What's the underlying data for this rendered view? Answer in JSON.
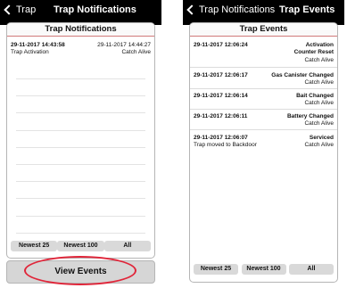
{
  "left_screen": {
    "nav_back_label": "Trap",
    "nav_title": "Trap Notifications",
    "panel_title": "Trap Notifications",
    "notification": {
      "left_time": "29-11-2017 14:43:58",
      "right_time": "29-11-2017 14:44:27",
      "type": "Trap Activation",
      "status": "Catch Alive"
    },
    "filters": [
      "Newest 25",
      "Newest 100",
      "All"
    ],
    "view_events_label": "View Events"
  },
  "right_screen": {
    "nav_back_label": "Trap Notifications",
    "nav_title": "Trap Events",
    "panel_title": "Trap Events",
    "events": [
      {
        "time": "29-11-2017 12:06:24",
        "title": "Activation",
        "title2": "Counter Reset",
        "status": "Catch Alive",
        "note": ""
      },
      {
        "time": "29-11-2017 12:06:17",
        "title": "Gas Canister Changed",
        "title2": "",
        "status": "Catch Alive",
        "note": ""
      },
      {
        "time": "29-11-2017 12:06:14",
        "title": "Bait Changed",
        "title2": "",
        "status": "Catch Alive",
        "note": ""
      },
      {
        "time": "29-11-2017 12:06:11",
        "title": "Battery Changed",
        "title2": "",
        "status": "Catch Alive",
        "note": ""
      },
      {
        "time": "29-11-2017 12:06:07",
        "title": "Serviced",
        "title2": "",
        "status": "Catch Alive",
        "note": "Trap moved to Backdoor"
      }
    ],
    "filters": [
      "Newest 25",
      "Newest 100",
      "All"
    ]
  },
  "colors": {
    "nav_bg": "#000000",
    "annotation_ring": "#e0263a",
    "button_bg": "#d9d9d9"
  }
}
